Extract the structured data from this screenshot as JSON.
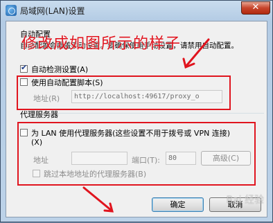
{
  "window": {
    "title": "局域网(LAN)设置",
    "close_glyph": "✕"
  },
  "auto_config": {
    "group_label": "自动配置",
    "description": "自动配置会覆盖手动设置。要确保使用手动设置，请禁用自动配置。",
    "auto_detect_label": "自动检测设置(A)",
    "auto_detect_checked": true,
    "use_script_label": "使用自动配置脚本(S)",
    "use_script_checked": false,
    "address_label": "地址(R)",
    "address_value": "http://localhost:49617/proxy_o"
  },
  "proxy": {
    "group_label": "代理服务器",
    "use_proxy_label": "为 LAN 使用代理服务器(这些设置不用于拨号或 VPN 连接)",
    "use_proxy_label_line2": "(X)",
    "use_proxy_checked": false,
    "address_label": "地址",
    "address_value": "",
    "port_label": "端口(T):",
    "port_value": "80",
    "advanced_label": "高级(C)",
    "bypass_label": "跳过本地地址的代理服务器(B)",
    "bypass_checked": false
  },
  "buttons": {
    "ok_label": "确定",
    "cancel_label": "取消"
  },
  "annotation_text": "修改成如图所示的样子",
  "watermark_text": "Bai 经验",
  "colors": {
    "annotation_red": "#e0141e",
    "title_bar": "#b3cbe4",
    "close_red": "#c7452b"
  }
}
